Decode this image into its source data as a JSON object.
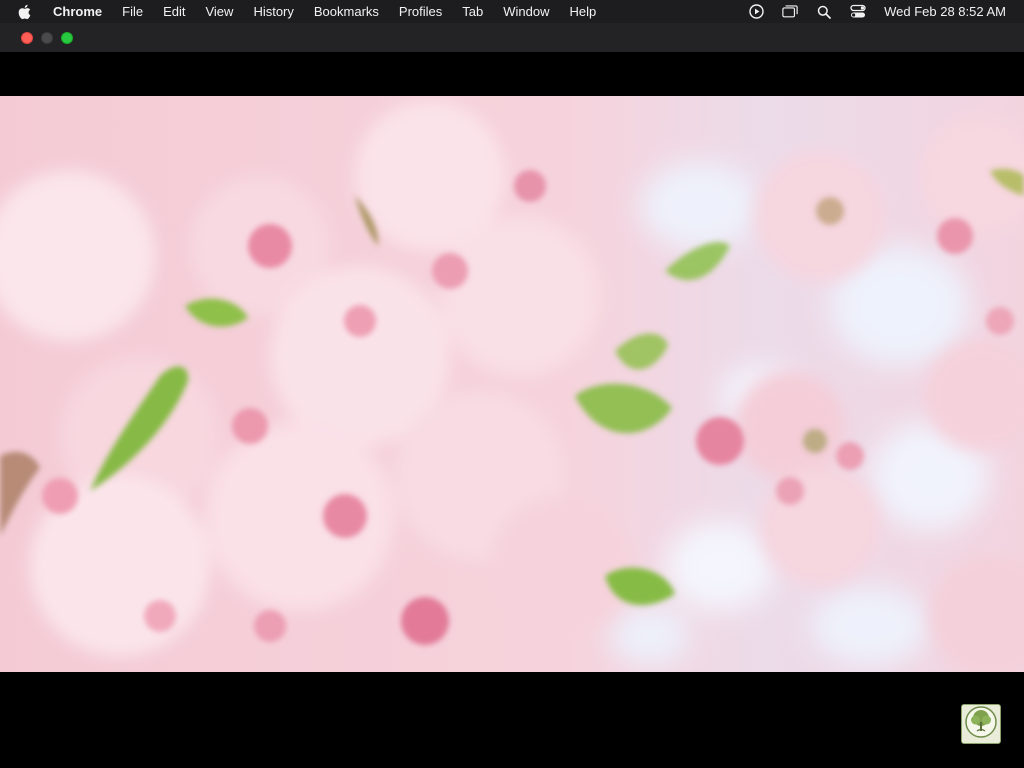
{
  "menubar": {
    "app_name": "Chrome",
    "menus": [
      "File",
      "Edit",
      "View",
      "History",
      "Bookmarks",
      "Profiles",
      "Tab",
      "Window",
      "Help"
    ],
    "status_icons": [
      "play-circle-icon",
      "screen-mirroring-icon",
      "spotlight-search-icon",
      "control-center-icon"
    ],
    "clock": "Wed Feb 28  8:52 AM"
  },
  "window": {
    "traffic_lights": [
      "close",
      "minimize",
      "zoom"
    ]
  },
  "video": {
    "content": "cherry-blossom-video-frame",
    "colors": {
      "blossom_pink": "#f3c9d3",
      "deep_pink": "#e27a98",
      "leaf_green": "#8fc04a",
      "sky_white": "#eef1fb"
    }
  },
  "watermark": {
    "icon": "tree-logo-icon"
  }
}
